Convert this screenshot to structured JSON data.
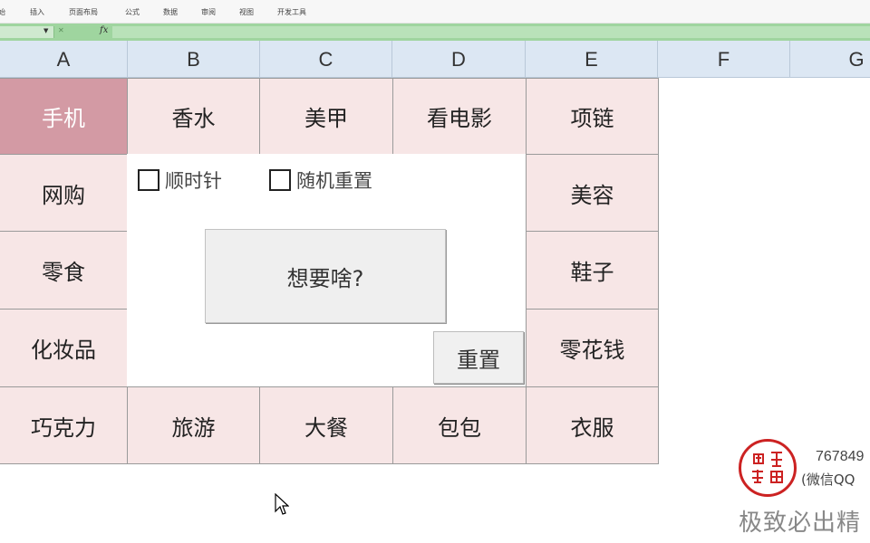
{
  "ribbon": {
    "tabs": [
      "始",
      "插入",
      "页面布局",
      "公式",
      "数据",
      "审阅",
      "视图",
      "开发工具"
    ]
  },
  "formula_bar": {
    "fx_label": "fx"
  },
  "columns": [
    "A",
    "B",
    "C",
    "D",
    "E",
    "F",
    "G"
  ],
  "grid": {
    "row1": [
      "手机",
      "香水",
      "美甲",
      "看电影",
      "项链"
    ],
    "left": [
      "网购",
      "零食",
      "化妆品"
    ],
    "right": [
      "美容",
      "鞋子",
      "零花钱"
    ],
    "row5": [
      "巧克力",
      "旅游",
      "大餐",
      "包包",
      "衣服"
    ]
  },
  "panel": {
    "checkbox_clockwise": "顺时针",
    "checkbox_random_reset": "随机重置",
    "main_button": "想要啥?",
    "reset_button": "重置"
  },
  "watermark": {
    "number": "767849",
    "contact": "(微信QQ",
    "slogan": "极致必出精"
  },
  "colors": {
    "cell_fill": "#f7e6e6",
    "active_cell_fill": "#d39aa4",
    "header_fill": "#dce7f3",
    "formula_bar": "#9fd59f",
    "seal": "#cc2222"
  }
}
